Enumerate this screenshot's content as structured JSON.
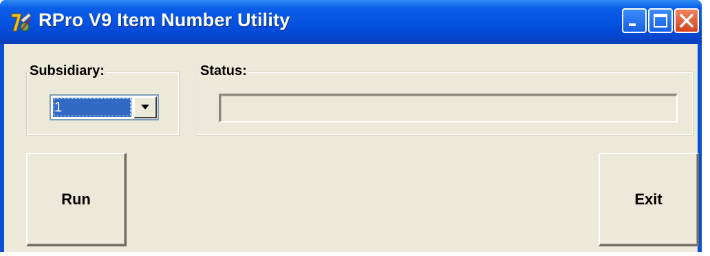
{
  "window": {
    "title": "RPro V9 Item Number Utility",
    "icon": "rpro-app-icon",
    "controls": [
      "minimize-icon",
      "maximize-icon",
      "close-icon"
    ],
    "colors": {
      "titlebar": "#0553e2",
      "client_bg": "#ece9d8",
      "close_button": "#d4441f",
      "selection": "#316ac5"
    }
  },
  "subsidiary": {
    "label": "Subsidiary:",
    "selected_value": "1"
  },
  "status": {
    "label": "Status:",
    "value": ""
  },
  "buttons": {
    "run_label": "Run",
    "exit_label": "Exit"
  }
}
